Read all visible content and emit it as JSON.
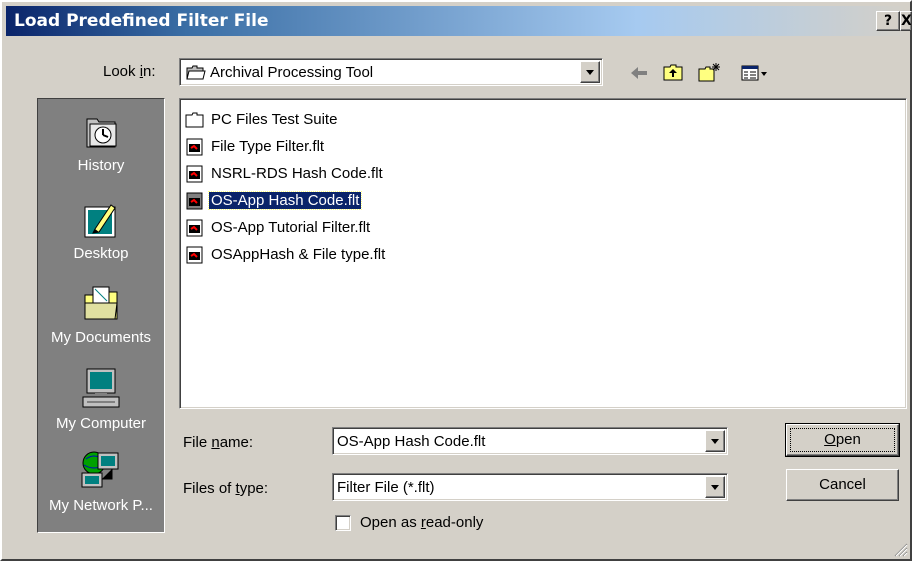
{
  "window": {
    "title": "Load Predefined Filter File",
    "help_label": "?",
    "close_label": "X"
  },
  "look_in": {
    "label_pre": "Look ",
    "label_key": "i",
    "label_post": "n:",
    "value": "Archival Processing Tool"
  },
  "toolbar": {
    "back": "back-arrow-icon",
    "up": "up-one-level-icon",
    "new_folder": "new-folder-icon",
    "views": "views-menu-icon"
  },
  "places": [
    {
      "label": "History",
      "icon": "history-icon"
    },
    {
      "label": "Desktop",
      "icon": "desktop-icon"
    },
    {
      "label": "My Documents",
      "icon": "my-documents-icon"
    },
    {
      "label": "My Computer",
      "icon": "my-computer-icon"
    },
    {
      "label": "My Network P...",
      "icon": "my-network-places-icon"
    }
  ],
  "files": [
    {
      "name": "PC Files Test Suite",
      "type": "folder"
    },
    {
      "name": "File Type Filter.flt",
      "type": "file"
    },
    {
      "name": "NSRL-RDS Hash Code.flt",
      "type": "file"
    },
    {
      "name": "OS-App Hash Code.flt",
      "type": "file",
      "selected": true
    },
    {
      "name": "OS-App Tutorial Filter.flt",
      "type": "file"
    },
    {
      "name": "OSAppHash & File type.flt",
      "type": "file"
    }
  ],
  "file_name": {
    "label_pre": "File ",
    "label_key": "n",
    "label_post": "ame:",
    "value": "OS-App Hash Code.flt"
  },
  "file_type": {
    "label_pre": "Files of ",
    "label_key": "t",
    "label_post": "ype:",
    "value": "Filter File (*.flt)"
  },
  "buttons": {
    "open_key": "O",
    "open_rest": "pen",
    "cancel": "Cancel"
  },
  "read_only": {
    "label_pre": "Open as ",
    "label_key": "r",
    "label_post": "ead-only",
    "checked": false
  },
  "colors": {
    "selection": "#0a246a",
    "title_bar": "#0a246a",
    "face": "#d4d0c8",
    "places_bg": "#808080"
  }
}
